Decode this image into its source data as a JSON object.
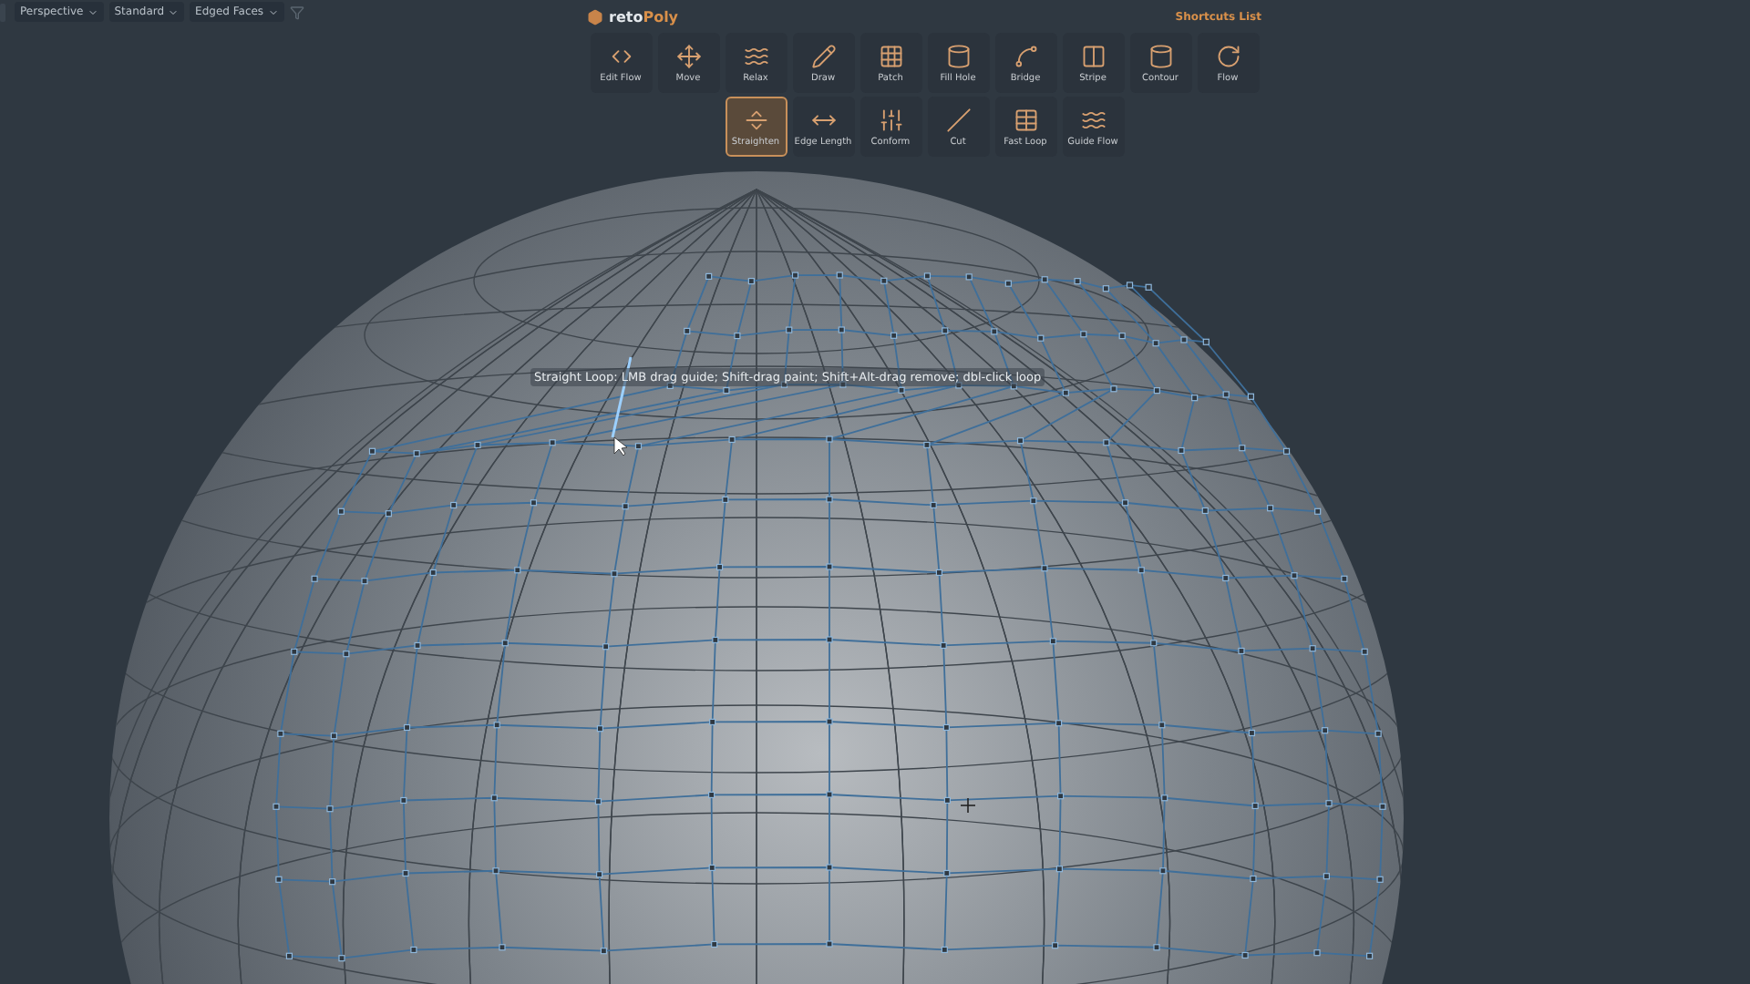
{
  "viewport_menus": [
    {
      "label": "Perspective"
    },
    {
      "label": "Standard"
    },
    {
      "label": "Edged Faces"
    }
  ],
  "brand": {
    "prefix": "reto",
    "suffix": "Poly"
  },
  "shortcuts_link": "Shortcuts List",
  "tool_rows": [
    [
      {
        "label": "Edit Flow",
        "selected": false
      },
      {
        "label": "Move",
        "selected": false
      },
      {
        "label": "Relax",
        "selected": false
      },
      {
        "label": "Draw",
        "selected": false
      },
      {
        "label": "Patch",
        "selected": false
      },
      {
        "label": "Fill Hole",
        "selected": false
      },
      {
        "label": "Bridge",
        "selected": false
      },
      {
        "label": "Stripe",
        "selected": false
      },
      {
        "label": "Contour",
        "selected": false
      },
      {
        "label": "Flow",
        "selected": false
      }
    ],
    [
      {
        "label": "Straighten",
        "selected": true
      },
      {
        "label": "Edge Length",
        "selected": false
      },
      {
        "label": "Conform",
        "selected": false
      },
      {
        "label": "Cut",
        "selected": false
      },
      {
        "label": "Fast Loop",
        "selected": false
      },
      {
        "label": "Guide Flow",
        "selected": false
      }
    ]
  ],
  "hint": "Straight Loop: LMB drag guide; Shift-drag paint; Shift+Alt-drag remove; dbl-click loop"
}
